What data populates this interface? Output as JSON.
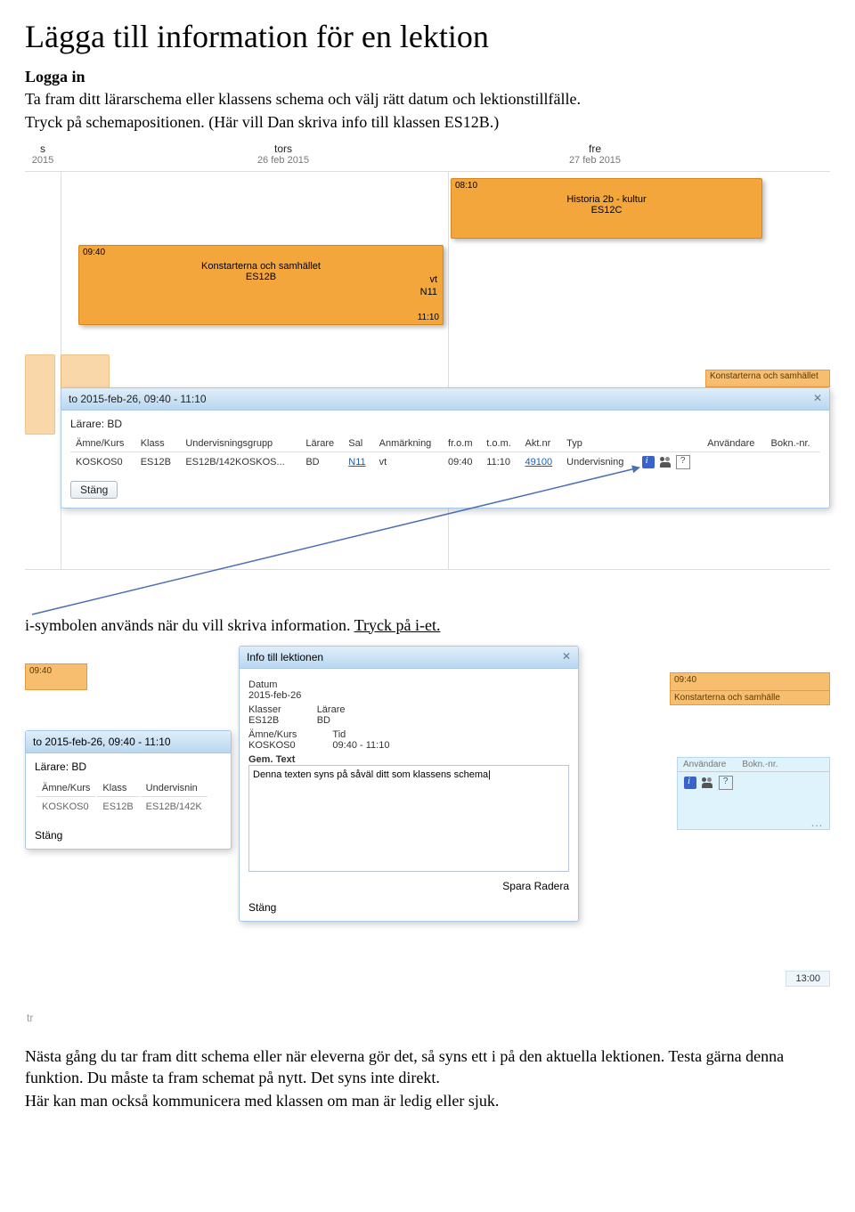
{
  "doc": {
    "title": "Lägga till information för en lektion",
    "login_heading": "Logga in",
    "intro_line1": "Ta fram ditt lärarschema eller klassens schema och välj rätt datum och lektionstillfälle.",
    "intro_line2": "Tryck på schemapositionen. (Här vill Dan skriva info till klassen ES12B.)",
    "mid_pre": "i",
    "mid_text": "-symbolen används när du vill skriva information. ",
    "mid_link": "Tryck på i-et.",
    "outro_1a": "Nästa gång du tar fram ditt schema eller när eleverna gör det, så syns ett ",
    "outro_1b": "i",
    "outro_1c": " på den aktuella lektionen. Testa gärna denna funktion. Du måste ta fram schemat på nytt. Det syns inte direkt.",
    "outro_2": "Här kan man också kommunicera med klassen om man är ledig eller sjuk."
  },
  "cal": {
    "col_s": "s",
    "col_s_date": "2015",
    "col_tors": "tors",
    "col_tors_date": "26 feb 2015",
    "col_fre": "fre",
    "col_fre_date": "27 feb 2015"
  },
  "ev_hist": {
    "start": "08:10",
    "title": "Historia 2b - kultur",
    "sub": "ES12C"
  },
  "ev_konst": {
    "start": "09:40",
    "end": "11:10",
    "title": "Konstarterna och samhället",
    "sub": "ES12B",
    "room_lbl": "vt",
    "room": "N11"
  },
  "ghost_label": "Konstarterna och samhället",
  "panel": {
    "title": "to 2015-feb-26, 09:40 - 11:10",
    "teacher_line": "Lärare: BD",
    "close_btn": "Stäng",
    "headers": {
      "amne": "Ämne/Kurs",
      "klass": "Klass",
      "grupp": "Undervisningsgrupp",
      "larare": "Lärare",
      "sal": "Sal",
      "anm": "Anmärkning",
      "from": "fr.o.m",
      "tom": "t.o.m.",
      "aktnr": "Akt.nr",
      "typ": "Typ",
      "anv": "Användare",
      "bokn": "Bokn.-nr."
    },
    "row": {
      "amne": "KOSKOS0",
      "klass": "ES12B",
      "grupp": "ES12B/142KOSKOS...",
      "larare": "BD",
      "sal": "N11",
      "anm": "vt",
      "from": "09:40",
      "tom": "11:10",
      "aktnr": "49100",
      "typ": "Undervisning"
    }
  },
  "shot2": {
    "left_time": "09:40",
    "right_time": "09:40",
    "right_label": "Konstarterna och samhälle",
    "panel_title": "to 2015-feb-26, 09:40 - 11:10",
    "panel_teacher": "Lärare: BD",
    "panel_btn": "Stäng",
    "rcol_hdr_anv": "Användare",
    "rcol_hdr_bokn": "Bokn.-nr.",
    "end_time": "13:00",
    "tr_label": "tr"
  },
  "panel2": {
    "headers": {
      "amne": "Ämne/Kurs",
      "klass": "Klass",
      "grupp": "Undervisnin"
    },
    "row": {
      "amne": "KOSKOS0",
      "klass": "ES12B",
      "grupp": "ES12B/142K"
    }
  },
  "dlg": {
    "title": "Info till lektionen",
    "date_lbl": "Datum",
    "date_val": "2015-feb-26",
    "klass_lbl": "Klasser",
    "klass_val": "ES12B",
    "larare_lbl": "Lärare",
    "larare_val": "BD",
    "amne_lbl": "Ämne/Kurs",
    "amne_val": "KOSKOS0",
    "tid_lbl": "Tid",
    "tid_val": "09:40 - 11:10",
    "gem_lbl": "Gem. Text",
    "textarea": "Denna texten syns på såväl ditt som klassens schema|",
    "save": "Spara",
    "delete": "Radera",
    "close": "Stäng"
  }
}
